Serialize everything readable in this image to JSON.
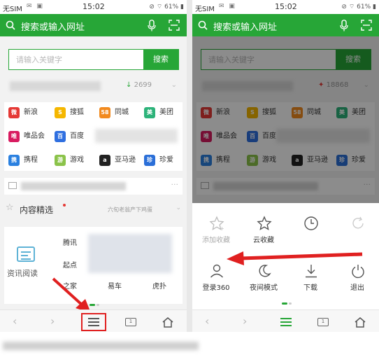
{
  "statusbar": {
    "carrier": "无SIM",
    "time": "15:02",
    "battery": "61%"
  },
  "topbar": {
    "placeholder_text": "搜索或输入网址",
    "icons": [
      "search-icon",
      "mic-icon",
      "scan-icon"
    ]
  },
  "search": {
    "placeholder": "请输入关键字",
    "button": "搜索"
  },
  "hot": {
    "left_count": "2699",
    "right_count": "18868"
  },
  "shortcuts": [
    {
      "label": "新浪",
      "icon": "weibo-icon",
      "color": "#e53935",
      "glyph": "微"
    },
    {
      "label": "搜狐",
      "icon": "sohu-icon",
      "color": "#f5b700",
      "glyph": "S"
    },
    {
      "label": "同城",
      "icon": "58-icon",
      "color": "#f28a1e",
      "glyph": "58"
    },
    {
      "label": "美团",
      "icon": "meituan-icon",
      "color": "#2db37a",
      "glyph": "美"
    },
    {
      "label": "唯品会",
      "icon": "vip-icon",
      "color": "#d81b60",
      "glyph": "唯"
    },
    {
      "label": "百度",
      "icon": "baidu-icon",
      "color": "#2f6fe0",
      "glyph": "百"
    },
    {
      "label": "携程",
      "icon": "ctrip-icon",
      "color": "#2a80e0",
      "glyph": "携"
    },
    {
      "label": "游戏",
      "icon": "game-icon",
      "color": "#8bc34a",
      "glyph": "游"
    },
    {
      "label": "亚马逊",
      "icon": "amazon-icon",
      "color": "#222222",
      "glyph": "a"
    },
    {
      "label": "珍爱",
      "icon": "zhenai-icon",
      "color": "#2b6fd8",
      "glyph": "珍"
    }
  ],
  "right_partial": {
    "baidu": "百度",
    "amazon": "亚马逊"
  },
  "featured": {
    "title": "内容精选",
    "subtitle": "六旬老翁产下鸡蛋"
  },
  "news": {
    "title": "资讯阅读",
    "words": [
      "腾讯",
      "起点",
      "之家",
      "易车",
      "虎扑"
    ]
  },
  "menu": {
    "items": [
      {
        "label": "添加收藏",
        "icon": "add-bookmark-icon",
        "enabled": false
      },
      {
        "label": "云收藏",
        "icon": "star-icon",
        "enabled": true
      },
      {
        "label": "",
        "icon": "history-clock-icon",
        "enabled": true
      },
      {
        "label": "",
        "icon": "refresh-icon",
        "enabled": false
      },
      {
        "label": "登录360",
        "icon": "user-icon",
        "enabled": true
      },
      {
        "label": "夜间模式",
        "icon": "moon-icon",
        "enabled": true
      },
      {
        "label": "下载",
        "icon": "download-icon",
        "enabled": true
      },
      {
        "label": "退出",
        "icon": "power-icon",
        "enabled": true
      }
    ]
  },
  "colors": {
    "brand_green": "#27a637",
    "annotation_red": "#e02020"
  }
}
